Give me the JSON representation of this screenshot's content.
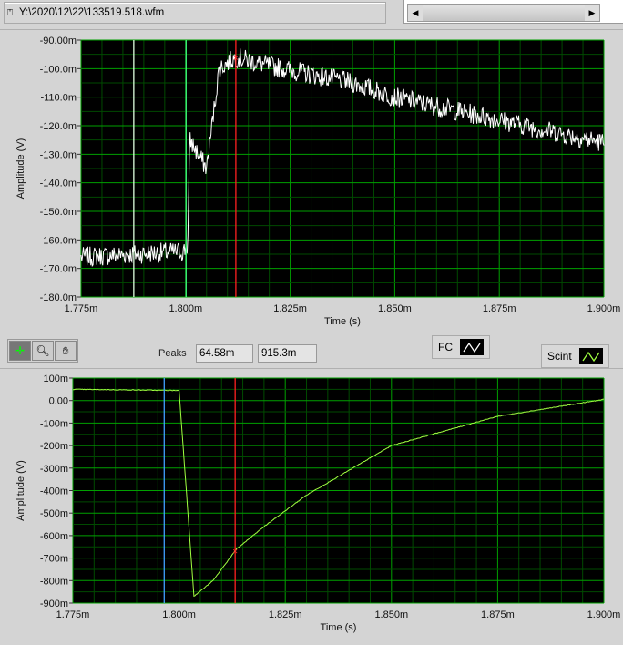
{
  "file_path": {
    "icon": "path-icon",
    "value": "Y:\\2020\\12\\22\\133519.518.wfm"
  },
  "scroll": {
    "left": "◀",
    "right": "▶"
  },
  "graph_top": {
    "y_label": "Amplitude (V)",
    "x_label": "Time (s)",
    "y_ticks": [
      "-90.00m",
      "-100.0m",
      "-110.0m",
      "-120.0m",
      "-130.0m",
      "-140.0m",
      "-150.0m",
      "-160.0m",
      "-170.0m",
      "-180.0m"
    ],
    "x_ticks": [
      "1.775m",
      "1.800m",
      "1.825m",
      "1.850m",
      "1.875m",
      "1.900m"
    ]
  },
  "graph_bottom": {
    "y_label": "Amplitude (V)",
    "x_label": "Time (s)",
    "y_ticks": [
      "100m",
      "0.00",
      "-100m",
      "-200m",
      "-300m",
      "-400m",
      "-500m",
      "-600m",
      "-700m",
      "-800m",
      "-900m"
    ],
    "x_ticks": [
      "1.775m",
      "1.800m",
      "1.825m",
      "1.850m",
      "1.875m",
      "1.900m"
    ]
  },
  "toolbar": {
    "cursor": "cursor-tool-icon",
    "zoom": "zoom-tool-icon",
    "pan": "pan-hand-icon"
  },
  "peaks": {
    "label": "Peaks",
    "value1": "64.58m",
    "value2": "915.3m"
  },
  "legend": {
    "fc": "FC",
    "scint": "Scint"
  },
  "colors": {
    "fc": "#ffffff",
    "scint": "#a0ff40",
    "grid_major": "#00a000",
    "grid_minor": "#004a00",
    "cursor_red": "#ff2020",
    "cursor_blue": "#40a0ff"
  },
  "chart_data": [
    {
      "type": "line",
      "title": "FC",
      "xlabel": "Time (s)",
      "ylabel": "Amplitude (V)",
      "xlim": [
        1.775,
        1.9
      ],
      "ylim": [
        -180,
        -90
      ],
      "x_units": "ms",
      "y_units": "mV",
      "series": [
        {
          "name": "FC",
          "x": [
            1.775,
            1.7995,
            1.8005,
            1.801,
            1.805,
            1.808,
            1.812,
            1.82,
            1.84,
            1.85,
            1.875,
            1.9
          ],
          "y": [
            -166,
            -164,
            -162,
            -125,
            -135,
            -100,
            -96,
            -99,
            -105,
            -110,
            -118,
            -126
          ]
        }
      ],
      "cursors": [
        1.7876,
        1.8001,
        1.812
      ]
    },
    {
      "type": "line",
      "title": "Scint",
      "xlabel": "Time (s)",
      "ylabel": "Amplitude (V)",
      "xlim": [
        1.775,
        1.9
      ],
      "ylim": [
        -900,
        100
      ],
      "x_units": "ms",
      "y_units": "mV",
      "series": [
        {
          "name": "Scint",
          "x": [
            1.775,
            1.7995,
            1.8,
            1.8035,
            1.808,
            1.8135,
            1.82,
            1.83,
            1.85,
            1.875,
            1.9
          ],
          "y": [
            50,
            45,
            45,
            -870,
            -800,
            -660,
            -560,
            -420,
            -200,
            -70,
            5
          ]
        }
      ],
      "cursors": [
        1.7965,
        1.8132
      ]
    }
  ]
}
